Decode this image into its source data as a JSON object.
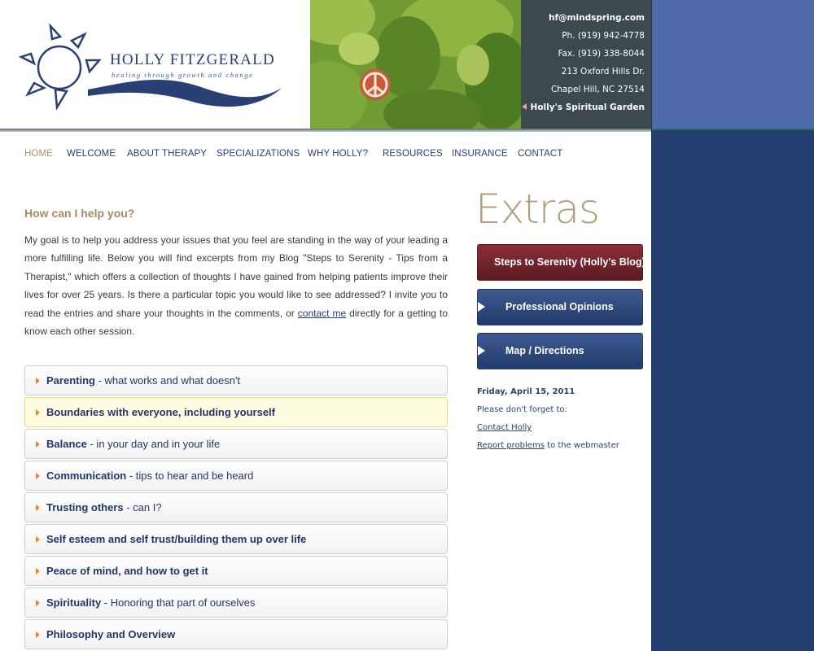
{
  "brand": {
    "name": "HOLLY FITZGERALD",
    "tagline": "healing through growth and change"
  },
  "contact": {
    "email": "hf@mindspring.com",
    "phone": "Ph. (919) 942-4778",
    "fax": "Fax. (919) 338-8044",
    "street": "213 Oxford Hills Dr.",
    "city": "Chapel Hill, NC 27514",
    "garden_link": "Holly's Spiritual Garden"
  },
  "nav": {
    "items": [
      "HOME",
      "WELCOME",
      "ABOUT THERAPY",
      "SPECIALIZATIONS",
      "WHY HOLLY?",
      "RESOURCES",
      "INSURANCE",
      "CONTACT"
    ]
  },
  "main": {
    "heading": "How can I help you?",
    "intro_before": "My goal is to help you address your issues that you feel are standing in the way of your leading a more fulfilling life. Below you will find excerpts from my Blog \"Steps to Serenity - Tips from a Therapist,\" which offers a collection of thoughts I have gained from helping patients improve their lives for over 25 years. Is there a particular topic you would like to see addressed? I invite you to read the entries and share your thoughts in the comments, or ",
    "intro_link": "contact me",
    "intro_after": " directly for a getting to know each other session."
  },
  "topics": [
    {
      "title": "Parenting",
      "rest": " - what works and what doesn't"
    },
    {
      "title": "Boundaries with everyone, including yourself",
      "rest": ""
    },
    {
      "title": "Balance",
      "rest": " - in your day and in your life"
    },
    {
      "title": "Communication",
      "rest": " - tips to hear and be heard"
    },
    {
      "title": "Trusting others",
      "rest": " - can I?"
    },
    {
      "title": "Self esteem and self trust/building them up over life",
      "rest": ""
    },
    {
      "title": "Peace of mind, and how to get it",
      "rest": ""
    },
    {
      "title": "Spirituality",
      "rest": " - Honoring that part of ourselves"
    },
    {
      "title": "Philosophy and Overview",
      "rest": ""
    }
  ],
  "sidebar": {
    "title": "Extras",
    "buttons": [
      "Steps to Serenity (Holly's Blog)",
      "Professional Opinions",
      "Map / Directions"
    ],
    "date": "Friday, April 15, 2011",
    "reminder": "Please don't forget to:",
    "contact_link": "Contact Holly",
    "report_link": "Report problems",
    "report_rest": " to the webmaster"
  },
  "colors": {
    "navy": "#25407a",
    "gold": "#a88b5e",
    "blog_button": "#7a2430",
    "side_blue": "#233e6e"
  }
}
